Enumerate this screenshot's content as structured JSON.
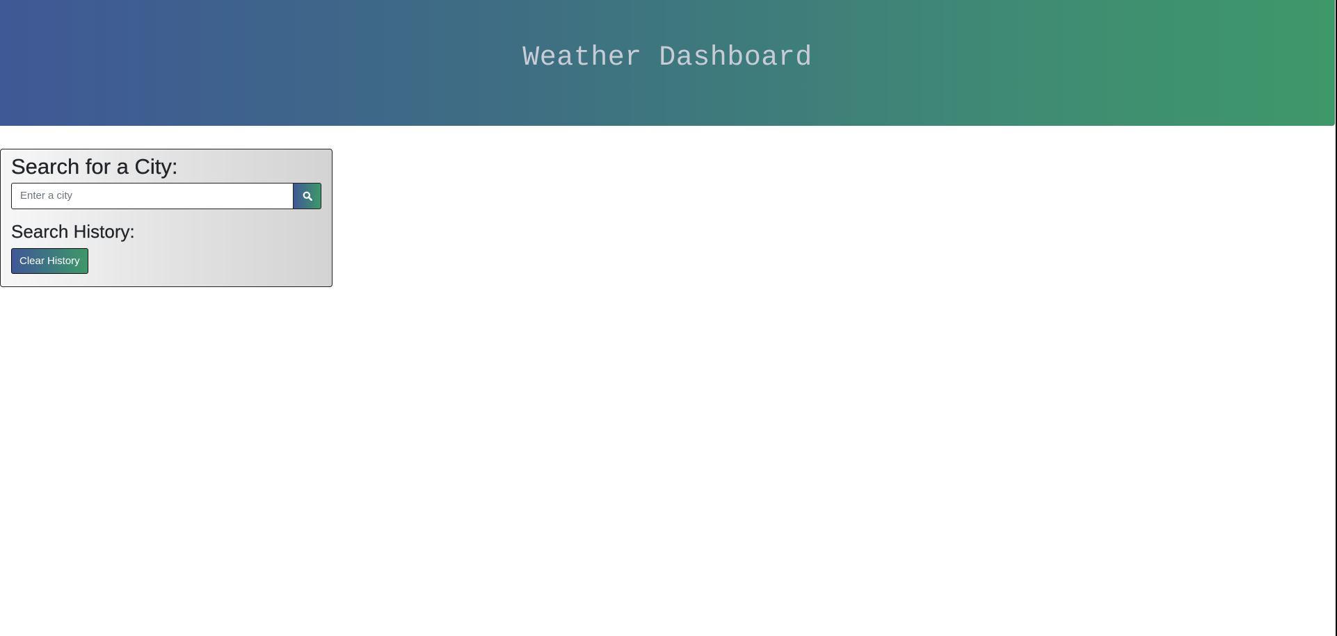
{
  "header": {
    "title": "Weather Dashboard"
  },
  "search": {
    "heading": "Search for a City:",
    "placeholder": "Enter a city",
    "value": "",
    "button_icon": "search-icon"
  },
  "history": {
    "heading": "Search History:",
    "clear_label": "Clear History",
    "items": []
  },
  "colors": {
    "gradient_start": "#3f5896",
    "gradient_end": "#3e9869",
    "title_text": "#c8ccd6",
    "panel_light": "#f7f7f7",
    "panel_dark": "#d3d3d3"
  }
}
